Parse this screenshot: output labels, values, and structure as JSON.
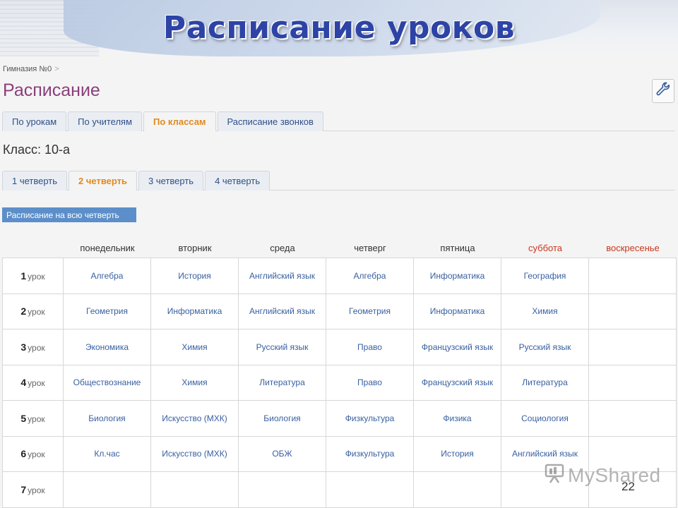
{
  "slide": {
    "title": "Расписание уроков",
    "number": "22"
  },
  "breadcrumb": {
    "school": "Гимназия №0",
    "separator": ">"
  },
  "page_title": "Расписание",
  "main_tabs": [
    {
      "label": "По урокам",
      "active": false
    },
    {
      "label": "По учителям",
      "active": false
    },
    {
      "label": "По классам",
      "active": true
    },
    {
      "label": "Расписание звонков",
      "active": false
    }
  ],
  "class_label": "Класс: 10-а",
  "quarter_tabs": [
    {
      "label": "1 четверть",
      "active": false
    },
    {
      "label": "2 четверть",
      "active": true
    },
    {
      "label": "3 четверть",
      "active": false
    },
    {
      "label": "4 четверть",
      "active": false
    }
  ],
  "whole_quarter_button": "Расписание на всю четверть",
  "days": [
    {
      "label": "понедельник",
      "weekend": false
    },
    {
      "label": "вторник",
      "weekend": false
    },
    {
      "label": "среда",
      "weekend": false
    },
    {
      "label": "четверг",
      "weekend": false
    },
    {
      "label": "пятница",
      "weekend": false
    },
    {
      "label": "суббота",
      "weekend": true
    },
    {
      "label": "воскресенье",
      "weekend": true
    }
  ],
  "lesson_word": "урок",
  "rows": [
    {
      "num": "1",
      "cells": [
        "Алгебра",
        "История",
        "Английский язык",
        "Алгебра",
        "Информатика",
        "География",
        ""
      ]
    },
    {
      "num": "2",
      "cells": [
        "Геометрия",
        "Информатика",
        "Английский язык",
        "Геометрия",
        "Информатика",
        "Химия",
        ""
      ]
    },
    {
      "num": "3",
      "cells": [
        "Экономика",
        "Химия",
        "Русский язык",
        "Право",
        "Французский язык",
        "Русский язык",
        ""
      ]
    },
    {
      "num": "4",
      "cells": [
        "Обществознание",
        "Химия",
        "Литература",
        "Право",
        "Французский язык",
        "Литература",
        ""
      ]
    },
    {
      "num": "5",
      "cells": [
        "Биология",
        "Искусство (МХК)",
        "Биология",
        "Физкультура",
        "Физика",
        "Социология",
        ""
      ]
    },
    {
      "num": "6",
      "cells": [
        "Кл.час",
        "Искусство (МХК)",
        "ОБЖ",
        "Физкультура",
        "История",
        "Английский язык",
        ""
      ]
    },
    {
      "num": "7",
      "cells": [
        "",
        "",
        "",
        "",
        "",
        "",
        ""
      ]
    }
  ],
  "watermark": "MyShared",
  "colors": {
    "title": "#2d43a6",
    "page_title": "#8b3f7a",
    "link": "#3860a0",
    "active_tab": "#e08a1e",
    "weekend": "#c8371f",
    "button": "#5c8fc9"
  },
  "icons": {
    "settings": "wrench-icon",
    "watermark": "slideshow-icon"
  }
}
